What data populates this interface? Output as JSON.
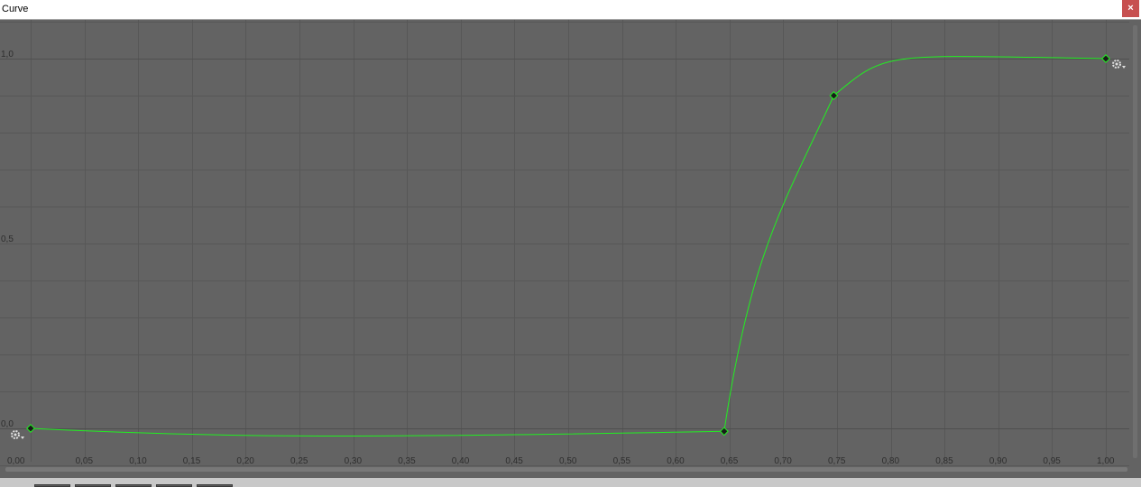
{
  "window": {
    "title": "Curve",
    "close_label": "×"
  },
  "curve_editor": {
    "x_ticks": [
      "0,00",
      "0,05",
      "0,10",
      "0,15",
      "0,20",
      "0,25",
      "0,30",
      "0,35",
      "0,40",
      "0,45",
      "0,50",
      "0,55",
      "0,60",
      "0,65",
      "0,70",
      "0,75",
      "0,80",
      "0,85",
      "0,90",
      "0,95",
      "1,00"
    ],
    "y_ticks": [
      "0,0",
      "0,5",
      "1,0"
    ],
    "keyframes": [
      {
        "time": 0.0,
        "value": 0.0
      },
      {
        "time": 0.645,
        "value": -0.008
      },
      {
        "time": 0.747,
        "value": 0.9
      },
      {
        "time": 1.0,
        "value": 1.0
      }
    ],
    "colors": {
      "curve": "#22ee22",
      "background": "#636363",
      "grid": "#555555",
      "keyframe": "#22ee22"
    },
    "icons": {
      "pre_wrap": "gear-icon",
      "post_wrap": "gear-icon"
    }
  },
  "preset_bar": {
    "preset_count": 5
  }
}
